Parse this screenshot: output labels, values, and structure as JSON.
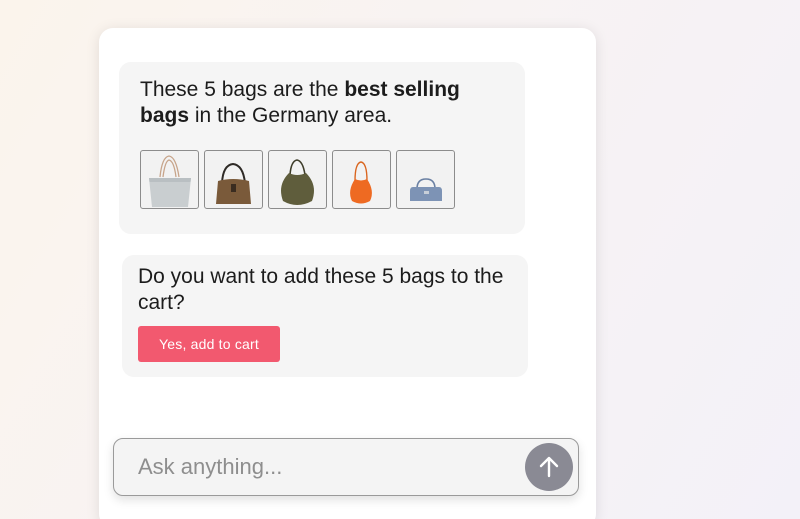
{
  "chat": {
    "message_1": {
      "text_before": "These 5 bags are the ",
      "text_bold": "best selling bags",
      "text_after": " in the Germany area.",
      "products": [
        {
          "icon": "light-gray-tote-bag-icon",
          "color": "#c9ced0"
        },
        {
          "icon": "brown-shoulder-bag-icon",
          "color": "#7a5a3a"
        },
        {
          "icon": "olive-hobo-bag-icon",
          "color": "#5f5d3c"
        },
        {
          "icon": "orange-hobo-bag-icon",
          "color": "#ee6a22"
        },
        {
          "icon": "blue-crossbody-bag-icon",
          "color": "#7d93b5"
        }
      ]
    },
    "message_2": {
      "question": "Do you want to add these 5 bags to the cart?",
      "button_label": "Yes, add to cart"
    }
  },
  "composer": {
    "placeholder": "Ask anything...",
    "send_icon": "arrow-up-icon"
  },
  "colors": {
    "accent_button": "#f2596f",
    "send_button": "#8a8a94",
    "bubble_bg": "#f5f5f5"
  }
}
